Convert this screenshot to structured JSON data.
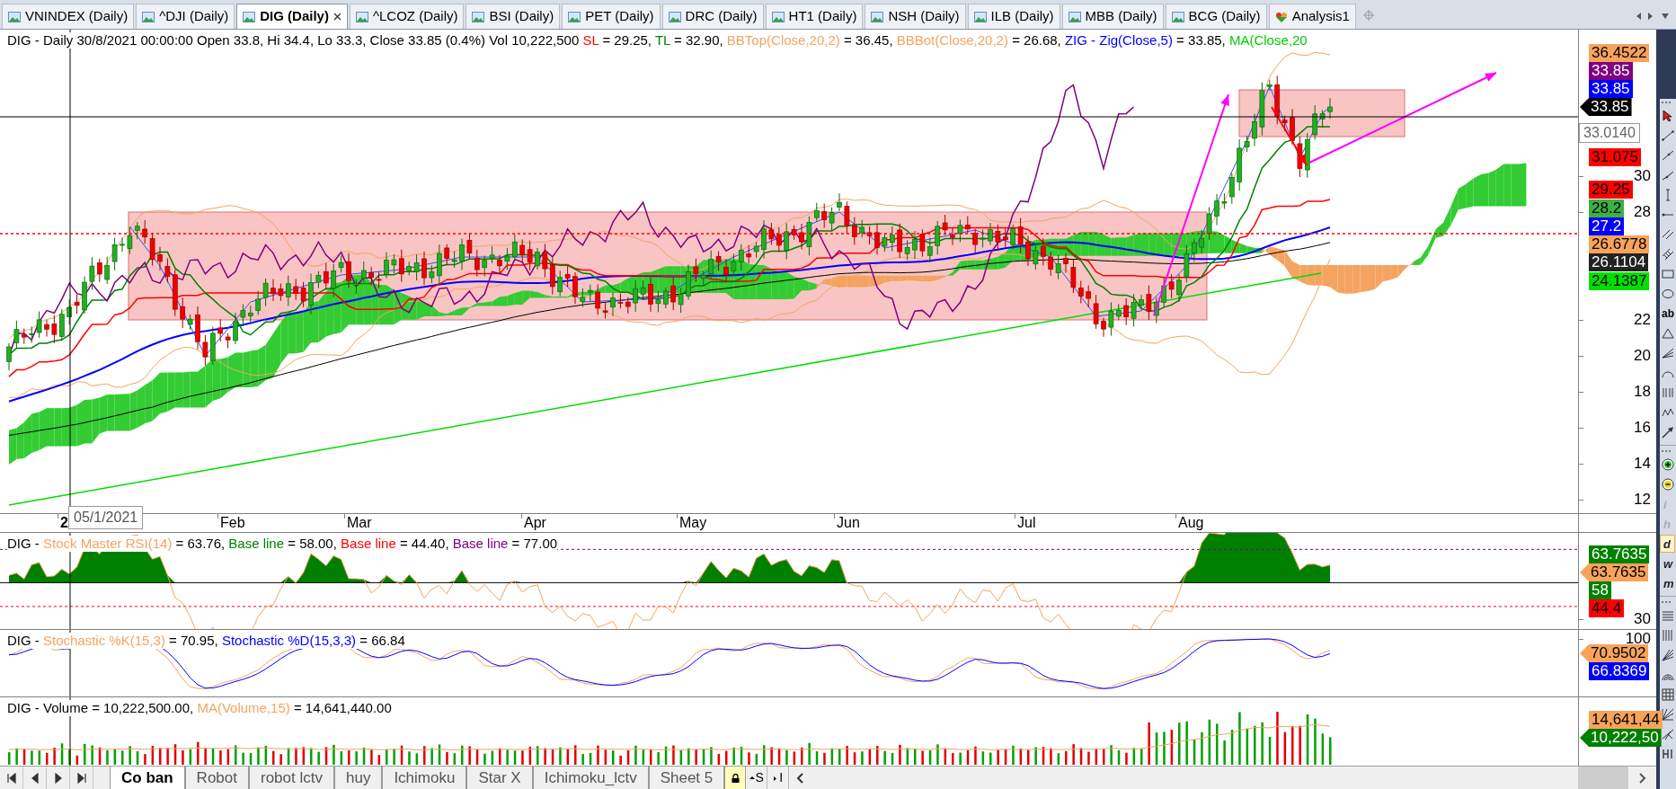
{
  "tabs": [
    {
      "label": "VNINDEX (Daily)",
      "kind": "chart",
      "selected": false
    },
    {
      "label": "^DJI (Daily)",
      "kind": "chart",
      "selected": false
    },
    {
      "label": "DIG (Daily)",
      "kind": "chart",
      "selected": true
    },
    {
      "label": "^LCOZ (Daily)",
      "kind": "chart",
      "selected": false
    },
    {
      "label": "BSI (Daily)",
      "kind": "chart",
      "selected": false
    },
    {
      "label": "PET (Daily)",
      "kind": "chart",
      "selected": false
    },
    {
      "label": "DRC (Daily)",
      "kind": "chart",
      "selected": false
    },
    {
      "label": "HT1 (Daily)",
      "kind": "chart",
      "selected": false
    },
    {
      "label": "NSH (Daily)",
      "kind": "chart",
      "selected": false
    },
    {
      "label": "ILB (Daily)",
      "kind": "chart",
      "selected": false
    },
    {
      "label": "MBB (Daily)",
      "kind": "chart",
      "selected": false
    },
    {
      "label": "BCG (Daily)",
      "kind": "chart",
      "selected": false
    },
    {
      "label": "Analysis1",
      "kind": "analysis",
      "selected": false
    }
  ],
  "main_panel": {
    "legend": [
      {
        "text": "DIG - Daily 30/8/2021 00:00:00 Open 33.8, Hi 34.4, Lo 33.3, Close 33.85 (0.4%) Vol 10,222,500 "
      },
      {
        "text": "SL",
        "color": "#ff0000"
      },
      {
        "text": " = 29.25, "
      },
      {
        "text": "TL",
        "color": "#008000"
      },
      {
        "text": " = 32.90, "
      },
      {
        "text": "BBTop(Close,20,2)",
        "color": "#f4a460"
      },
      {
        "text": " = 36.45, "
      },
      {
        "text": "BBBot(Close,20,2)",
        "color": "#f4a460"
      },
      {
        "text": " = 26.68, "
      },
      {
        "text": "ZIG - Zig(Close,5)",
        "color": "#0000ff"
      },
      {
        "text": " = 33.85, "
      },
      {
        "text": "MA(Close,20",
        "color": "#00cc00"
      }
    ],
    "axis_ticks": [
      "30",
      "28",
      "22",
      "20",
      "18",
      "16",
      "14",
      "12"
    ],
    "value_tags": [
      {
        "text": "36.4522",
        "color": "#f7a35c",
        "light_label": false,
        "pointer": false
      },
      {
        "text": "33.85",
        "color": "#800080",
        "light_label": true,
        "pointer": false
      },
      {
        "text": "33.85",
        "color": "#0000ff",
        "light_label": true,
        "pointer": false
      },
      {
        "text": "33.85",
        "color": "#000000",
        "light_label": true,
        "pointer": true
      },
      {
        "text": "31.075",
        "color": "#ff0000",
        "light_label": false,
        "pointer": false
      },
      {
        "text": "29.25",
        "color": "#ff0000",
        "light_label": false,
        "pointer": false
      },
      {
        "text": "28.2",
        "color": "#3cb043",
        "light_label": false,
        "pointer": false
      },
      {
        "text": "27.2",
        "color": "#0000ff",
        "light_label": true,
        "pointer": false
      },
      {
        "text": "26.6778",
        "color": "#f7a35c",
        "light_label": false,
        "pointer": false
      },
      {
        "text": "26.1104",
        "color": "#222222",
        "light_label": true,
        "pointer": false
      },
      {
        "text": "24.1387",
        "color": "#00e000",
        "light_label": false,
        "pointer": false
      }
    ],
    "cursor_price": "33.0140",
    "date_labels": [
      "2",
      "Feb",
      "Mar",
      "Apr",
      "May",
      "Jun",
      "Jul",
      "Aug"
    ],
    "cursor_date": "05/1/2021"
  },
  "rsi_panel": {
    "legend": [
      {
        "text": "DIG - "
      },
      {
        "text": "Stock Master RSI(14)",
        "color": "#f4a460"
      },
      {
        "text": " = 63.76, "
      },
      {
        "text": "Base line",
        "color": "#008000"
      },
      {
        "text": " = 58.00, "
      },
      {
        "text": "Base line",
        "color": "#ff0000"
      },
      {
        "text": " = 44.40, "
      },
      {
        "text": "Base line",
        "color": "#800080"
      },
      {
        "text": " = 77.00"
      }
    ],
    "axis_ticks": [
      "30"
    ],
    "value_tags": [
      {
        "text": "63.7635",
        "color": "#008000",
        "light_label": true,
        "pointer": false
      },
      {
        "text": "63.7635",
        "color": "#f7a35c",
        "light_label": false,
        "pointer": true
      },
      {
        "text": "58",
        "color": "#008000",
        "light_label": true,
        "pointer": false
      },
      {
        "text": "44.4",
        "color": "#ff0000",
        "light_label": false,
        "pointer": false
      }
    ]
  },
  "stochastic_panel": {
    "legend": [
      {
        "text": "DIG - "
      },
      {
        "text": "Stochastic %K(15,3)",
        "color": "#f4a460"
      },
      {
        "text": " = 70.95, "
      },
      {
        "text": "Stochastic %D(15,3,3)",
        "color": "#0000ff"
      },
      {
        "text": " = 66.84"
      }
    ],
    "axis_ticks": [
      "100"
    ],
    "value_tags": [
      {
        "text": "70.9502",
        "color": "#f7a35c",
        "light_label": false,
        "pointer": true
      },
      {
        "text": "66.8369",
        "color": "#0000ff",
        "light_label": true,
        "pointer": false
      }
    ]
  },
  "volume_panel": {
    "legend": [
      {
        "text": "DIG - Volume = 10,222,500.00, "
      },
      {
        "text": "MA(Volume,15)",
        "color": "#f4a460"
      },
      {
        "text": " = 14,641,440.00"
      }
    ],
    "value_tags": [
      {
        "text": "14,641,44",
        "color": "#f7a35c",
        "light_label": false,
        "pointer": false
      },
      {
        "text": "10,222,50",
        "color": "#008000",
        "light_label": true,
        "pointer": true
      }
    ]
  },
  "sheet_tabs": [
    {
      "label": "Co ban",
      "selected": true
    },
    {
      "label": "Robot",
      "selected": false
    },
    {
      "label": "robot lctv",
      "selected": false
    },
    {
      "label": "huy",
      "selected": false
    },
    {
      "label": "Ichimoku",
      "selected": false
    },
    {
      "label": "Star X",
      "selected": false
    },
    {
      "label": "Ichimoku_lctv",
      "selected": false
    },
    {
      "label": "Sheet 5",
      "selected": false
    }
  ],
  "sheet_buttons": [
    "S",
    "I"
  ],
  "toolbar": {
    "text_tool": "ab",
    "intervals": [
      {
        "label": "i",
        "selected": false,
        "disabled": true
      },
      {
        "label": "h",
        "selected": false,
        "disabled": true
      },
      {
        "label": "d",
        "selected": true,
        "disabled": false
      },
      {
        "label": "w",
        "selected": false,
        "disabled": false
      },
      {
        "label": "m",
        "selected": false,
        "disabled": false
      }
    ]
  }
}
